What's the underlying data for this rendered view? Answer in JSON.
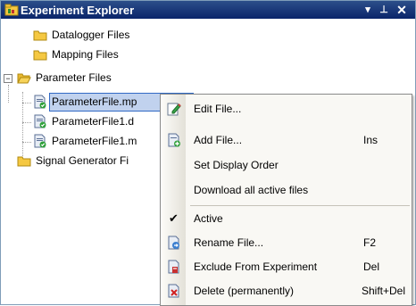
{
  "window": {
    "title": "Experiment Explorer",
    "dropdown_glyph": "▾",
    "pin_glyph": "⊥",
    "close_glyph": "✕"
  },
  "tree": {
    "expander_glyph": "−",
    "items": [
      {
        "label": "Datalogger Files",
        "icon": "folder-icon"
      },
      {
        "label": "Mapping Files",
        "icon": "folder-icon"
      },
      {
        "label": "Parameter Files",
        "icon": "folder-open-icon"
      },
      {
        "label": "ParameterFile.mp",
        "icon": "parameter-file-icon"
      },
      {
        "label": "ParameterFile1.d",
        "icon": "parameter-file-icon"
      },
      {
        "label": "ParameterFile1.m",
        "icon": "parameter-file-icon"
      },
      {
        "label": "Signal Generator Fi",
        "icon": "folder-icon"
      }
    ]
  },
  "context_menu": {
    "items": [
      {
        "label": "Edit File...",
        "shortcut": "",
        "icon": "edit-file-icon"
      },
      {
        "label": "Add File...",
        "shortcut": "Ins",
        "icon": "add-file-icon"
      },
      {
        "label": "Set Display Order",
        "shortcut": "",
        "icon": ""
      },
      {
        "label": "Download all active files",
        "shortcut": "",
        "icon": ""
      },
      {
        "label": "Active",
        "shortcut": "",
        "icon": "checkmark-icon",
        "checked": true
      },
      {
        "label": "Rename File...",
        "shortcut": "F2",
        "icon": "rename-file-icon"
      },
      {
        "label": "Exclude From Experiment",
        "shortcut": "Del",
        "icon": "exclude-file-icon"
      },
      {
        "label": "Delete (permanently)",
        "shortcut": "Shift+Del",
        "icon": "delete-file-icon"
      }
    ],
    "check_glyph": "✔"
  },
  "colors": {
    "titlebar": "#0a246a",
    "selection": "#c1d2ee",
    "menu_background": "#f9f8f4",
    "folder": "#f5c842"
  }
}
